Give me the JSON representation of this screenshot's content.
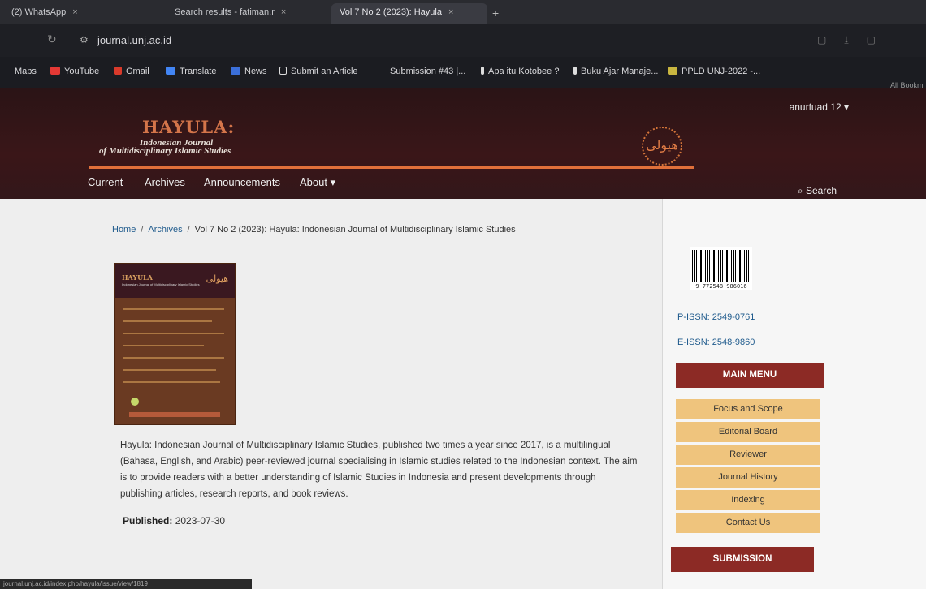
{
  "browser": {
    "tabs": [
      {
        "label": "(2) WhatsApp"
      },
      {
        "label": "Search results - fatiman.r"
      },
      {
        "label": "Vol 7 No 2 (2023): Hayula"
      }
    ],
    "url": "journal.unj.ac.id",
    "bookmarks": [
      {
        "label": "Maps"
      },
      {
        "label": "YouTube"
      },
      {
        "label": "Gmail"
      },
      {
        "label": "Translate"
      },
      {
        "label": "News"
      },
      {
        "label": "Submit an Article"
      },
      {
        "label": "Submission #43 |..."
      },
      {
        "label": "Apa itu Kotobee ?"
      },
      {
        "label": "Buku Ajar Manaje..."
      },
      {
        "label": "PPLD UNJ-2022 -..."
      },
      {
        "label": "All Bookm"
      }
    ],
    "status_url": "journal.unj.ac.id/index.php/hayula/issue/view/1819"
  },
  "header": {
    "user": "anurfuad  12",
    "logo_title": "HAYULA:",
    "logo_sub1": "Indonesian Journal",
    "logo_sub2": "of Multidisciplinary Islamic Studies",
    "logo_arabic": "هيولى",
    "nav": [
      "Current",
      "Archives",
      "Announcements",
      "About ▾"
    ],
    "search_label": "Search"
  },
  "main": {
    "breadcrumb": {
      "home": "Home",
      "archives": "Archives",
      "current": "Vol 7 No 2 (2023): Hayula: Indonesian Journal of Multidisciplinary Islamic Studies"
    },
    "cover": {
      "title": "HAYULA",
      "sub": "Indonesian Journal of Multidisciplinary Islamic Studies",
      "arabic": "هيولى"
    },
    "description": "Hayula: Indonesian Journal of Multidisciplinary Islamic Studies, published two times a year since 2017, is a multilingual (Bahasa, English, and Arabic) peer-reviewed journal specialising in Islamic studies related to the Indonesian context. The aim is to provide readers with a better understanding of Islamic Studies in Indonesia and present developments through publishing articles, research reports, and book reviews.",
    "published_label": "Published:",
    "published_date": "2023-07-30"
  },
  "sidebar": {
    "barcode_digits": "9 772548 986016",
    "p_issn": "P-ISSN: 2549-0761",
    "e_issn": "E-ISSN: 2548-9860",
    "main_menu": "MAIN MENU",
    "menu_items": [
      "Focus and Scope",
      "Editorial Board",
      "Reviewer",
      "Journal History",
      "Indexing",
      "Contact Us"
    ],
    "submission": "SUBMISSION"
  },
  "colors": {
    "header_bg": "#3a1618",
    "accent_orange": "#e0703a",
    "menu_red": "#8c2a25",
    "menu_tan": "#efc47d",
    "link_blue": "#1e5a8c"
  }
}
